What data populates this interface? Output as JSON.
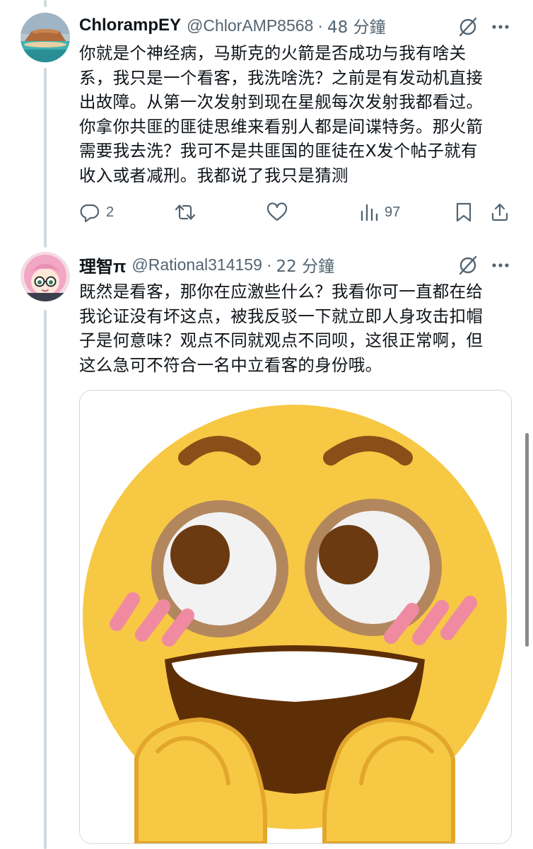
{
  "tweets": [
    {
      "display_name": "ChlorampEY",
      "handle": "@ChlorAMP8568",
      "separator": "·",
      "time": "48 分鐘",
      "text_lines": [
        "你就是个神经病，马斯克的火箭是否成功与我有啥关",
        "系，我只是一个看客，我洗啥洗？之前是有发动机直接",
        "出故障。从第一次发射到现在星舰每次发射我都看过。",
        "你拿你共匪的匪徒思维来看别人都是间谍特务。那火箭",
        "需要我去洗？我可不是共匪国的匪徒在X发个帖子就有",
        "收入或者减刑。我都说了我只是猜测"
      ],
      "reply_count": "2",
      "view_count": "97",
      "avatar_icon": "landscape-avatar-icon"
    },
    {
      "display_name": "理智π",
      "handle": "@Rational314159",
      "separator": "·",
      "time": "22 分鐘",
      "text_lines": [
        "既然是看客，那你在应激些什么？我看你可一直都在给",
        "我论证没有坏这点，被我反驳一下就立即人身攻击扣帽",
        "子是何意味？观点不同就观点不同呗，这很正常啊，但",
        "这么急可不符合一名中立看客的身份哦。"
      ],
      "avatar_icon": "anime-girl-avatar-icon",
      "media": "blushing-grinning-emoji-image"
    }
  ],
  "icons": {
    "grok": "grok-icon",
    "more": "more-options-icon",
    "reply": "reply-icon",
    "retweet": "retweet-icon",
    "like": "like-icon",
    "views": "views-icon",
    "bookmark": "bookmark-icon",
    "share": "share-icon"
  },
  "colors": {
    "text": "#0f1419",
    "secondary": "#536471",
    "thread_line": "#cfd9de",
    "emoji_face": "#f7c843",
    "emoji_blush": "#f08aa0"
  }
}
